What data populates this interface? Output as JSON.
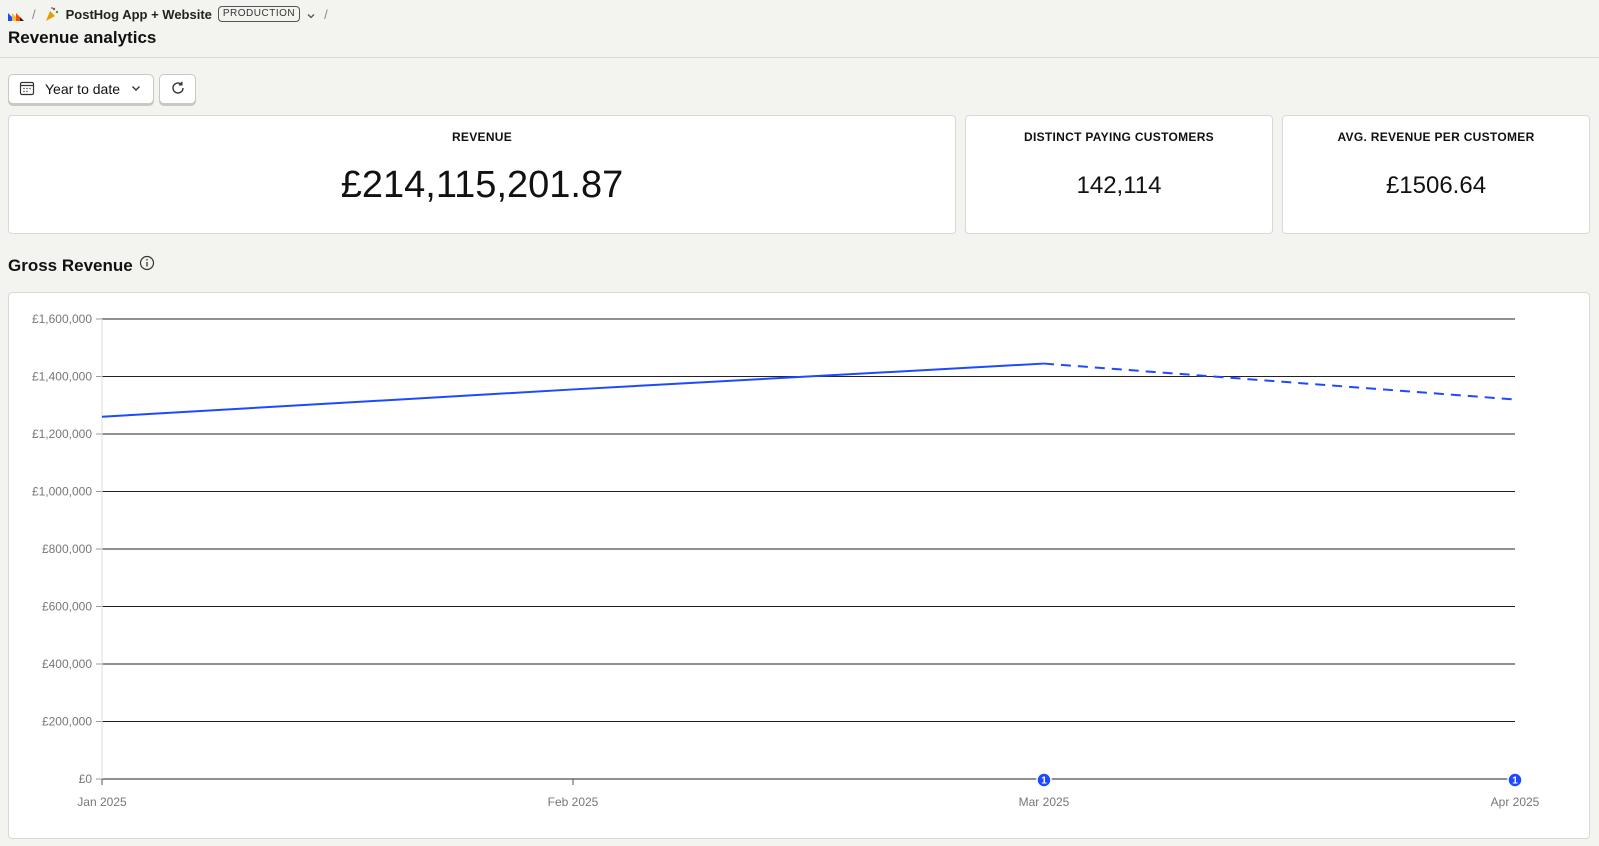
{
  "breadcrumb": {
    "project_name": "PostHog App + Website",
    "environment": "PRODUCTION"
  },
  "page": {
    "title": "Revenue analytics"
  },
  "controls": {
    "date_range_label": "Year to date"
  },
  "stats": {
    "revenue": {
      "label": "REVENUE",
      "value": "£214,115,201.87"
    },
    "customers": {
      "label": "DISTINCT PAYING CUSTOMERS",
      "value": "142,114"
    },
    "avg": {
      "label": "AVG. REVENUE PER CUSTOMER",
      "value": "£1506.64"
    }
  },
  "section": {
    "title": "Gross Revenue"
  },
  "colors": {
    "series": "#1d4aff",
    "grid": "#222222"
  },
  "chart_data": {
    "type": "line",
    "categories": [
      "Jan 2025",
      "Feb 2025",
      "Mar 2025",
      "Apr 2025"
    ],
    "series": [
      {
        "values": [
          1260000,
          1355000,
          1445000,
          1320000
        ]
      }
    ],
    "dashed_from_index": 2,
    "ylim": [
      0,
      1600000
    ],
    "yticks": [
      "£0",
      "£200,000",
      "£400,000",
      "£600,000",
      "£800,000",
      "£1,000,000",
      "£1,200,000",
      "£1,400,000",
      "£1,600,000"
    ],
    "annotations": [
      {
        "category": "Mar 2025",
        "label": "1"
      },
      {
        "category": "Apr 2025",
        "label": "1"
      }
    ],
    "grid": true
  }
}
